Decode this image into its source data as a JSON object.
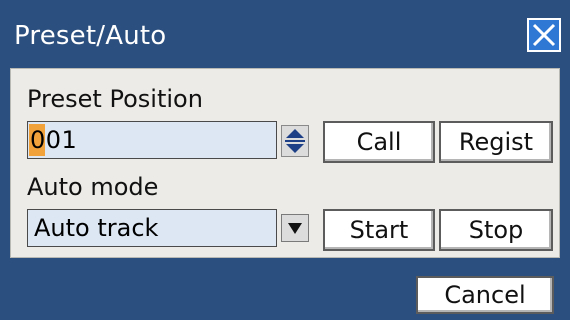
{
  "window": {
    "title": "Preset/Auto",
    "close_icon": "close-icon",
    "colors": {
      "frame": "#2b4f7e",
      "close_button": "#2f78d4",
      "panel": "#ecebe7",
      "field": "#dce7f3",
      "cursor": "#f2a23a"
    }
  },
  "preset": {
    "label": "Preset Position",
    "number_first": "0",
    "number_rest": "01",
    "stepper_icon": "up-down-arrows-icon",
    "call_label": "Call",
    "regist_label": "Regist"
  },
  "auto": {
    "label": "Auto mode",
    "selected_value": "Auto track",
    "dropdown_icon": "chevron-down-icon",
    "start_label": "Start",
    "stop_label": "Stop"
  },
  "footer": {
    "cancel_label": "Cancel"
  }
}
